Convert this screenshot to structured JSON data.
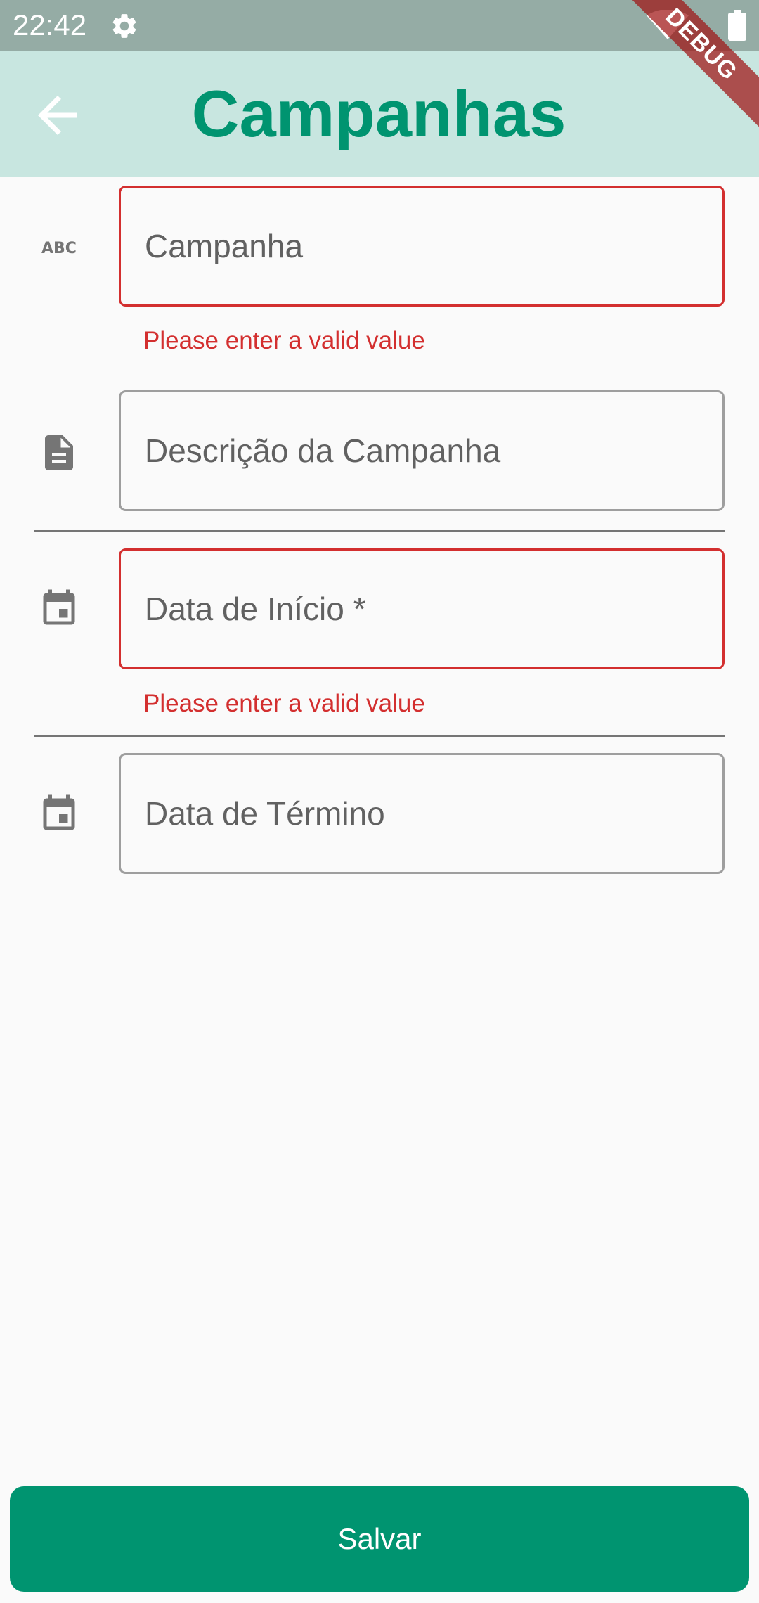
{
  "status_bar": {
    "time": "22:42"
  },
  "app_bar": {
    "title": "Campanhas"
  },
  "debug_banner": "DEBUG",
  "form": {
    "campaign": {
      "label": "Campanha",
      "error": "Please enter a valid value",
      "icon": "abc-icon"
    },
    "description": {
      "label": "Descrição da Campanha",
      "icon": "document-icon"
    },
    "start_date": {
      "label": "Data de Início *",
      "error": "Please enter a valid value",
      "icon": "calendar-icon"
    },
    "end_date": {
      "label": "Data de Término",
      "icon": "calendar-icon"
    }
  },
  "save_button": {
    "label": "Salvar"
  },
  "colors": {
    "accent": "#009470",
    "app_bar": "#c8e6e0",
    "error": "#d32f2f",
    "status_bar": "#95aca5"
  }
}
